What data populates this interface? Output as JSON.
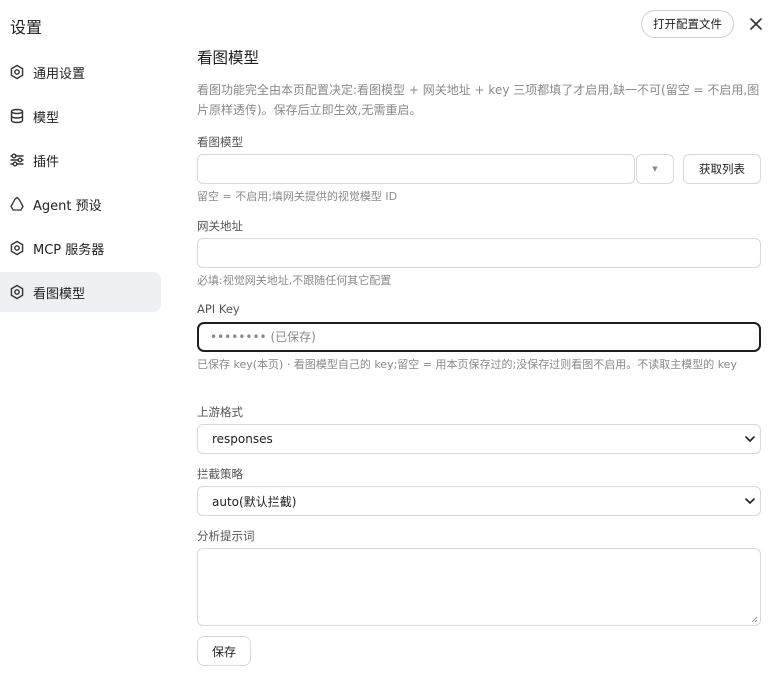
{
  "app": {
    "title": "设置"
  },
  "header": {
    "open_config_label": "打开配置文件"
  },
  "sidebar": {
    "items": [
      {
        "label": "通用设置",
        "icon": "gear-icon"
      },
      {
        "label": "模型",
        "icon": "database-icon"
      },
      {
        "label": "插件",
        "icon": "sliders-icon"
      },
      {
        "label": "Agent 预设",
        "icon": "recycle-icon"
      },
      {
        "label": "MCP 服务器",
        "icon": "gear-icon"
      },
      {
        "label": "看图模型",
        "icon": "gear-icon",
        "active": true
      }
    ]
  },
  "main": {
    "title": "看图模型",
    "description": "看图功能完全由本页配置决定:看图模型 + 网关地址 + key 三项都填了才启用,缺一不可(留空 = 不启用,图片原样透传)。保存后立即生效,无需重启。",
    "vision_model": {
      "label": "看图模型",
      "value": "",
      "fetch_label": "获取列表",
      "hint": "留空 = 不启用;填网关提供的视觉模型 ID"
    },
    "gateway": {
      "label": "网关地址",
      "value": "",
      "hint": "必填:视觉网关地址,不跟随任何其它配置"
    },
    "api_key": {
      "label": "API Key",
      "placeholder": "•••••••• (已保存)",
      "hint": "已保存 key(本页) · 看图模型自己的 key;留空 = 用本页保存过的;没保存过则看图不启用。不读取主模型的 key"
    },
    "upstream_format": {
      "label": "上游格式",
      "selected": "responses"
    },
    "intercept_policy": {
      "label": "拦截策略",
      "selected": "auto(默认拦截)"
    },
    "analysis_prompt": {
      "label": "分析提示词",
      "value": ""
    },
    "save_label": "保存"
  },
  "colors": {
    "active_nav_bg": "#eef0f3",
    "focus_border": "#1f1f1f",
    "hint_text": "#8a8a8a"
  }
}
